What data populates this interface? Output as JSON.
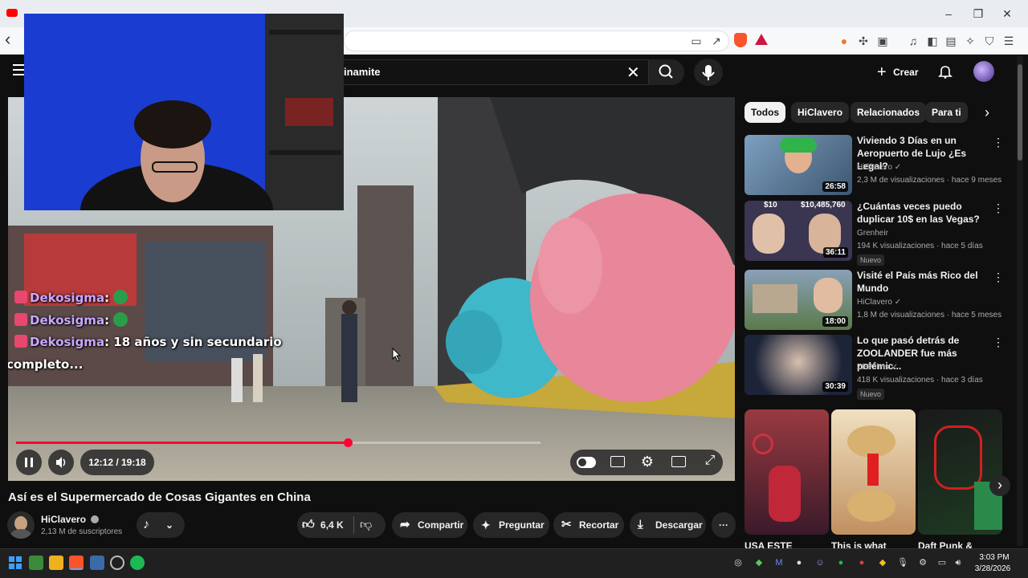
{
  "browser": {
    "nav_back": "‹",
    "window_controls": [
      "–",
      "❐",
      "✕"
    ]
  },
  "header": {
    "search_value": "dinamite",
    "search_visible": "inamite",
    "create_label": "Crear"
  },
  "video": {
    "title": "Así es el Supermercado de Cosas Gigantes en China",
    "time": "12:12 / 19:18",
    "progress_fraction": 0.632,
    "chat": [
      {
        "user": "Dekosigma",
        "message": ""
      },
      {
        "user": "Dekosigma",
        "message": ""
      },
      {
        "user": "Dekosigma",
        "message": "18 años y sin secundario"
      },
      {
        "user": "",
        "message": "completo..."
      }
    ]
  },
  "channel": {
    "name": "HiClavero",
    "subscribers": "2,13 M de suscriptores"
  },
  "actions": {
    "likes": "6,4 K",
    "share": "Compartir",
    "ask": "Preguntar",
    "clip": "Recortar",
    "download": "Descargar",
    "more": "···"
  },
  "chips": [
    "Todos",
    "HiClavero",
    "Relacionados",
    "Para ti"
  ],
  "recommendations": [
    {
      "title": "Viviendo 3 Días en un Aeropuerto de Lujo ¿Es Legal?",
      "channel": "HiClavero",
      "verified": true,
      "meta": "2,3 M de visualizaciones · hace 9 meses",
      "duration": "26:58",
      "nuevo": "",
      "thumb_color": "#5a7a9a"
    },
    {
      "title": "¿Cuántas veces puedo duplicar 10$ en las Vegas?",
      "channel": "Grenheir",
      "verified": false,
      "meta": "194 K visualizaciones · hace 5 días",
      "duration": "36:11",
      "nuevo": "Nuevo",
      "thumb_color": "#3a3550",
      "thumb_text_left": "$10",
      "thumb_text_right": "$10,485,760"
    },
    {
      "title": "Visité el País más Rico del Mundo",
      "channel": "HiClavero",
      "verified": true,
      "meta": "1,8 M de visualizaciones · hace 5 meses",
      "duration": "18:00",
      "nuevo": "",
      "thumb_color": "#6f8a5a"
    },
    {
      "title": "Lo que pasó detrás de ZOOLANDER fue más polémic...",
      "channel": "ZEPfilms",
      "verified": true,
      "meta": "418 K visualizaciones · hace 3 días",
      "duration": "30:39",
      "nuevo": "Nuevo",
      "thumb_color": "#1c2438"
    }
  ],
  "shorts": [
    {
      "title": "USA ESTE",
      "thumb_color": "#8a2a30"
    },
    {
      "title": "This is what",
      "thumb_color": "#caa070"
    },
    {
      "title": "Daft Punk &",
      "thumb_color": "#1e3a22"
    }
  ],
  "taskbar": {
    "time": "3:03 PM",
    "date": "3/28/2026"
  },
  "colors": {
    "accent_red": "#ff0033",
    "panel_bg": "#0f0f0f",
    "chip_active": "#f1f1f1"
  }
}
